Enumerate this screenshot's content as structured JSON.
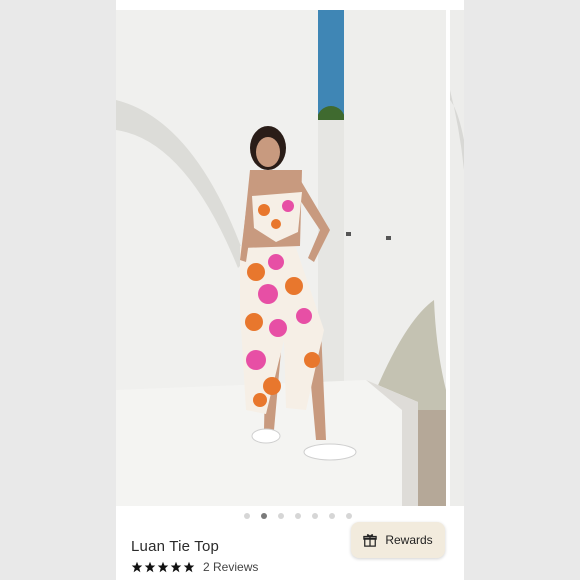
{
  "product": {
    "title": "Luan Tie Top",
    "rating": 5,
    "reviews_text": "2 Reviews"
  },
  "carousel": {
    "image_count": 7,
    "active_index": 1
  },
  "rewards_button": {
    "label": "Rewards",
    "icon": "gift-icon"
  },
  "colors": {
    "star": "#111111",
    "rewards_bg": "#f2ebdd",
    "dot_active": "#7a7a7a",
    "dot_inactive": "#d6d6d6"
  }
}
